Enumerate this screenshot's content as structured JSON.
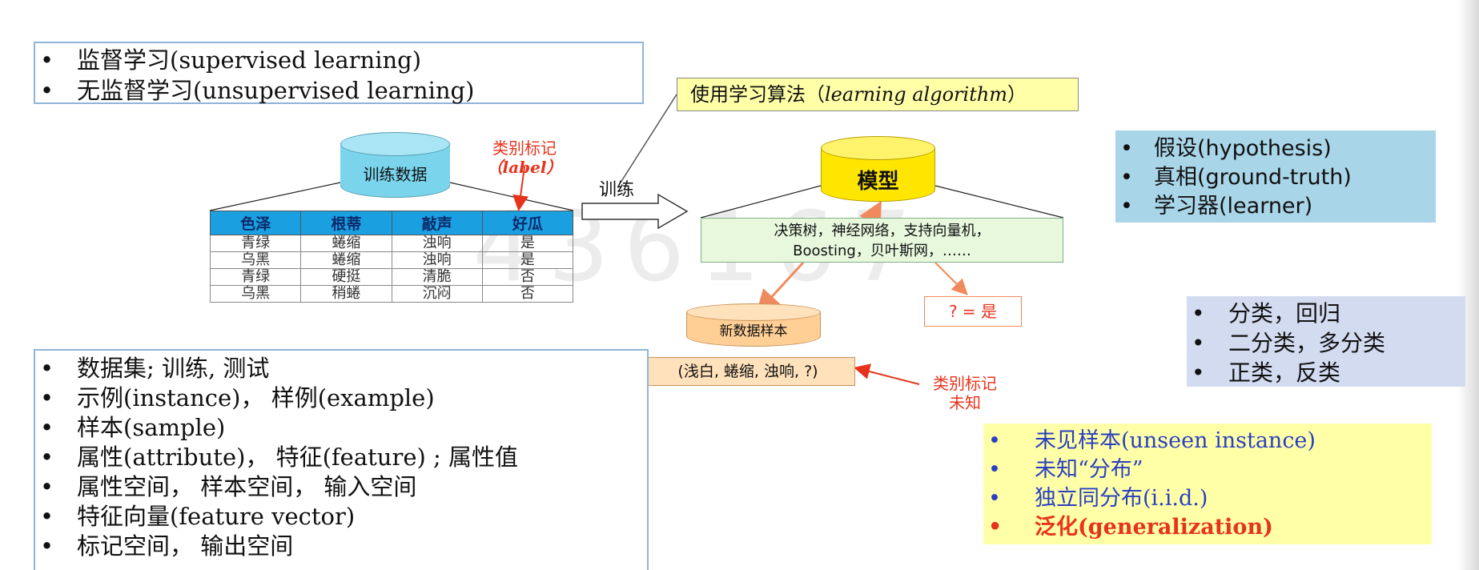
{
  "learning_types": [
    "监督学习(supervised learning)",
    "无监督学习(unsupervised learning)"
  ],
  "algorithm_box": {
    "text": "使用学习算法（",
    "italic": "learning algorithm",
    "close": "）"
  },
  "training_db": {
    "label": "训练数据"
  },
  "label_note": {
    "line1": "类别标记",
    "line2": "（label）"
  },
  "train_arrow": {
    "label": "训练"
  },
  "model_db": {
    "label": "模型"
  },
  "algorithms": {
    "line1": "决策树，神经网络，支持向量机，",
    "line2": "Boosting，贝叶斯网，……"
  },
  "table": {
    "headers": [
      "色泽",
      "根蒂",
      "敲声",
      "好瓜"
    ],
    "rows": [
      [
        "青绿",
        "蜷缩",
        "浊响",
        "是"
      ],
      [
        "乌黑",
        "蜷缩",
        "浊响",
        "是"
      ],
      [
        "青绿",
        "硬挺",
        "清脆",
        "否"
      ],
      [
        "乌黑",
        "稍蜷",
        "沉闷",
        "否"
      ]
    ]
  },
  "watermark": "436167",
  "new_sample_db": {
    "label": "新数据样本"
  },
  "sample_tuple": "(浅白, 蜷缩, 浊响, ?)",
  "unknown_label": {
    "line1": "类别标记",
    "line2": "未知"
  },
  "prediction": "? = 是",
  "hypothesis_list": [
    "假设(hypothesis)",
    "真相(ground-truth)",
    "学习器(learner)"
  ],
  "task_list": [
    "分类，回归",
    "二分类，多分类",
    "正类，反类"
  ],
  "concept_list": [
    "数据集; 训练, 测试",
    "示例(instance)， 样例(example)",
    "样本(sample)",
    "属性(attribute)， 特征(feature) ; 属性值",
    "属性空间， 样本空间， 输入空间",
    "特征向量(feature vector)",
    "标记空间， 输出空间"
  ],
  "generalization_list": [
    "未见样本(unseen instance)",
    "未知“分布”",
    "独立同分布(i.i.d.)",
    "泛化(generalization)"
  ],
  "colors": {
    "cyl_blue": "#79d4ec",
    "cyl_yellow": "#ffe600",
    "cyl_orange": "#ffcf96",
    "red": "#e8331c",
    "orange_arrow": "#f08a5d"
  }
}
